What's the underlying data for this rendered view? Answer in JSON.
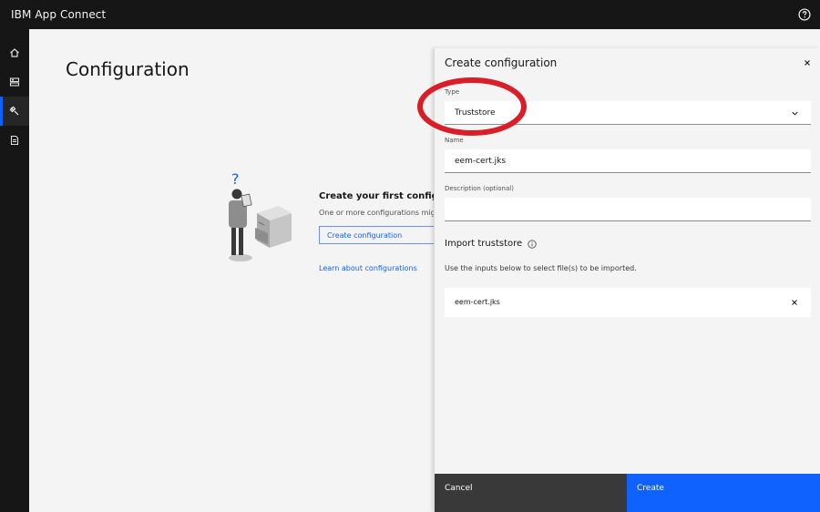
{
  "header": {
    "app_name": "IBM App Connect"
  },
  "rail": {
    "items": [
      "home",
      "dashboard",
      "configuration",
      "documents"
    ],
    "active": "configuration"
  },
  "main": {
    "title": "Configuration",
    "empty_state": {
      "title": "Create your first configura",
      "description": "One or more configurations might",
      "create_button": "Create configuration",
      "learn_link": "Learn about configurations"
    }
  },
  "panel": {
    "title": "Create configuration",
    "type": {
      "label": "Type",
      "value": "Truststore"
    },
    "name": {
      "label": "Name",
      "value": "eem-cert.jks"
    },
    "description": {
      "label": "Description (optional)",
      "value": ""
    },
    "import": {
      "title": "Import truststore",
      "description": "Use the inputs below to select file(s) to be imported.",
      "file": "eem-cert.jks"
    },
    "cancel_label": "Cancel",
    "create_label": "Create"
  },
  "colors": {
    "accent": "#0f62fe",
    "annotation": "#da1e28",
    "header_bg": "#161616"
  }
}
